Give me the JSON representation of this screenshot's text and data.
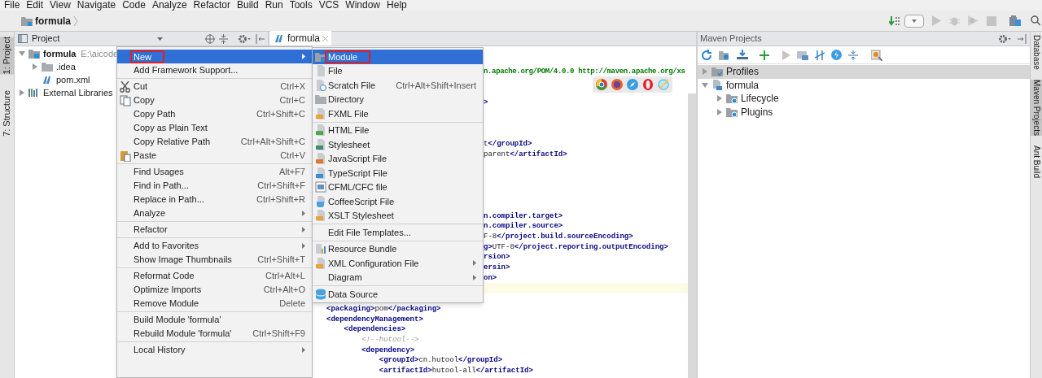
{
  "menu_bar": [
    "File",
    "Edit",
    "View",
    "Navigate",
    "Code",
    "Analyze",
    "Refactor",
    "Build",
    "Run",
    "Tools",
    "VCS",
    "Window",
    "Help"
  ],
  "navigation_bar": {
    "breadcrumb": "formula"
  },
  "left_tool_strip": [
    {
      "label": "1: Project",
      "selected": true
    },
    {
      "label": "7: Structure",
      "selected": false
    }
  ],
  "project_panel": {
    "title": "Project",
    "tree": [
      {
        "label": "formula",
        "path": "E:\\aicode",
        "expanded": true,
        "children": [
          {
            "label": ".idea",
            "expanded": false
          },
          {
            "label": "pom.xml"
          }
        ]
      },
      {
        "label": "External Libraries",
        "expanded": false
      }
    ]
  },
  "editor": {
    "tabs": [
      {
        "label": "formula",
        "selected": true
      }
    ],
    "lines": [
      {
        "kind": "tail-value",
        "text": "n.apache.org/POM/4.0.0 http://maven.apache.org/xs"
      },
      {
        "kind": "blank"
      },
      {
        "kind": "blank"
      },
      {
        "kind": "tail",
        "text": "**>**"
      },
      {
        "kind": "blank"
      },
      {
        "kind": "blank"
      },
      {
        "kind": "blank"
      },
      {
        "kind": "tail",
        "text": "t**</groupId>**"
      },
      {
        "kind": "tail",
        "text": "parent**</artifactId>**"
      },
      {
        "kind": "blank"
      },
      {
        "kind": "blank"
      },
      {
        "kind": "blank"
      },
      {
        "kind": "blank"
      },
      {
        "kind": "blank"
      },
      {
        "kind": "tail",
        "text": "**n.compiler.target>**"
      },
      {
        "kind": "tail",
        "text": "**n.compiler.source>**"
      },
      {
        "kind": "tail",
        "text": "F-8**</project.build.sourceEncoding>**"
      },
      {
        "kind": "tail",
        "text": "**g>**UTF-8**</project.reporting.outputEncoding>**"
      },
      {
        "kind": "tail",
        "text": "**rsion>**"
      },
      {
        "kind": "tail",
        "text": "**ersin>**"
      },
      {
        "kind": "tail",
        "text": "**on>**"
      },
      {
        "kind": "current"
      },
      {
        "kind": "blank"
      },
      {
        "kind": "code",
        "text": "**<packaging>**pom**</packaging>**"
      },
      {
        "kind": "code",
        "text": "**<dependencyManagement>**"
      },
      {
        "kind": "code",
        "text": "    **<dependencies>**"
      },
      {
        "kind": "code",
        "text": "        *<!--hutool-->*"
      },
      {
        "kind": "code",
        "text": "        **<dependency>**"
      },
      {
        "kind": "code",
        "text": "            **<groupId>**cn.hutool**</groupId>**"
      },
      {
        "kind": "code",
        "text": "            **<artifactId>**hutool-all**</artifactId>**"
      }
    ]
  },
  "context_menu": {
    "items": [
      {
        "kind": "item",
        "label": "New",
        "submenu": true,
        "selected": true,
        "marked": true
      },
      {
        "kind": "item",
        "label": "Add Framework Support...",
        "selected": false
      },
      {
        "kind": "separator"
      },
      {
        "kind": "item",
        "label": "Cut",
        "shortcut": "Ctrl+X",
        "selected": false
      },
      {
        "kind": "item",
        "label": "Copy",
        "shortcut": "Ctrl+C",
        "selected": false
      },
      {
        "kind": "item",
        "label": "Copy Path",
        "shortcut": "Ctrl+Shift+C",
        "selected": false
      },
      {
        "kind": "item",
        "label": "Copy as Plain Text",
        "selected": false
      },
      {
        "kind": "item",
        "label": "Copy Relative Path",
        "shortcut": "Ctrl+Alt+Shift+C",
        "selected": false
      },
      {
        "kind": "item",
        "label": "Paste",
        "shortcut": "Ctrl+V",
        "selected": false
      },
      {
        "kind": "separator"
      },
      {
        "kind": "item",
        "label": "Find Usages",
        "shortcut": "Alt+F7",
        "selected": false
      },
      {
        "kind": "item",
        "label": "Find in Path...",
        "shortcut": "Ctrl+Shift+F",
        "selected": false
      },
      {
        "kind": "item",
        "label": "Replace in Path...",
        "shortcut": "Ctrl+Shift+R",
        "selected": false
      },
      {
        "kind": "item",
        "label": "Analyze",
        "submenu": true,
        "selected": false
      },
      {
        "kind": "separator"
      },
      {
        "kind": "item",
        "label": "Refactor",
        "submenu": true,
        "selected": false
      },
      {
        "kind": "separator"
      },
      {
        "kind": "item",
        "label": "Add to Favorites",
        "submenu": true,
        "selected": false
      },
      {
        "kind": "item",
        "label": "Show Image Thumbnails",
        "shortcut": "Ctrl+Shift+T",
        "selected": false
      },
      {
        "kind": "separator"
      },
      {
        "kind": "item",
        "label": "Reformat Code",
        "shortcut": "Ctrl+Alt+L",
        "selected": false
      },
      {
        "kind": "item",
        "label": "Optimize Imports",
        "shortcut": "Ctrl+Alt+O",
        "selected": false
      },
      {
        "kind": "item",
        "label": "Remove Module",
        "shortcut": "Delete",
        "selected": false
      },
      {
        "kind": "separator"
      },
      {
        "kind": "item",
        "label": "Build Module 'formula'",
        "selected": false
      },
      {
        "kind": "item",
        "label": "Rebuild Module 'formula'",
        "shortcut": "Ctrl+Shift+F9",
        "selected": false
      },
      {
        "kind": "separator"
      },
      {
        "kind": "item",
        "label": "Local History",
        "submenu": true,
        "selected": false
      }
    ]
  },
  "submenu": {
    "items": [
      {
        "kind": "item",
        "label": "Module",
        "selected": true,
        "marked": true
      },
      {
        "kind": "item",
        "label": "File",
        "selected": false
      },
      {
        "kind": "item",
        "label": "Scratch File",
        "shortcut": "Ctrl+Alt+Shift+Insert",
        "selected": false
      },
      {
        "kind": "item",
        "label": "Directory",
        "selected": false
      },
      {
        "kind": "item",
        "label": "FXML File",
        "selected": false
      },
      {
        "kind": "separator"
      },
      {
        "kind": "item",
        "label": "HTML File",
        "selected": false
      },
      {
        "kind": "item",
        "label": "Stylesheet",
        "selected": false
      },
      {
        "kind": "item",
        "label": "JavaScript File",
        "selected": false
      },
      {
        "kind": "item",
        "label": "TypeScript File",
        "selected": false
      },
      {
        "kind": "item",
        "label": "CFML/CFC file",
        "selected": false
      },
      {
        "kind": "item",
        "label": "CoffeeScript File",
        "selected": false
      },
      {
        "kind": "item",
        "label": "XSLT Stylesheet",
        "selected": false
      },
      {
        "kind": "separator"
      },
      {
        "kind": "item",
        "label": "Edit File Templates...",
        "selected": false
      },
      {
        "kind": "separator"
      },
      {
        "kind": "item",
        "label": "Resource Bundle",
        "selected": false
      },
      {
        "kind": "item",
        "label": "XML Configuration File",
        "submenu": true,
        "selected": false
      },
      {
        "kind": "item",
        "label": "Diagram",
        "submenu": true,
        "selected": false
      },
      {
        "kind": "separator"
      },
      {
        "kind": "item",
        "label": "Data Source",
        "selected": false
      }
    ]
  },
  "maven_panel": {
    "title": "Maven Projects",
    "tree": [
      {
        "label": "Profiles",
        "expanded": false,
        "selected": true
      },
      {
        "label": "formula",
        "expanded": true,
        "selected": false,
        "children": [
          {
            "label": "Lifecycle",
            "expanded": false,
            "selected": false
          },
          {
            "label": "Plugins",
            "expanded": false,
            "selected": false
          }
        ]
      }
    ]
  },
  "right_tool_strip": [
    {
      "label": "Database",
      "selected": false
    },
    {
      "label": "Maven Projects",
      "selected": true
    },
    {
      "label": "Ant Build",
      "selected": false
    }
  ]
}
